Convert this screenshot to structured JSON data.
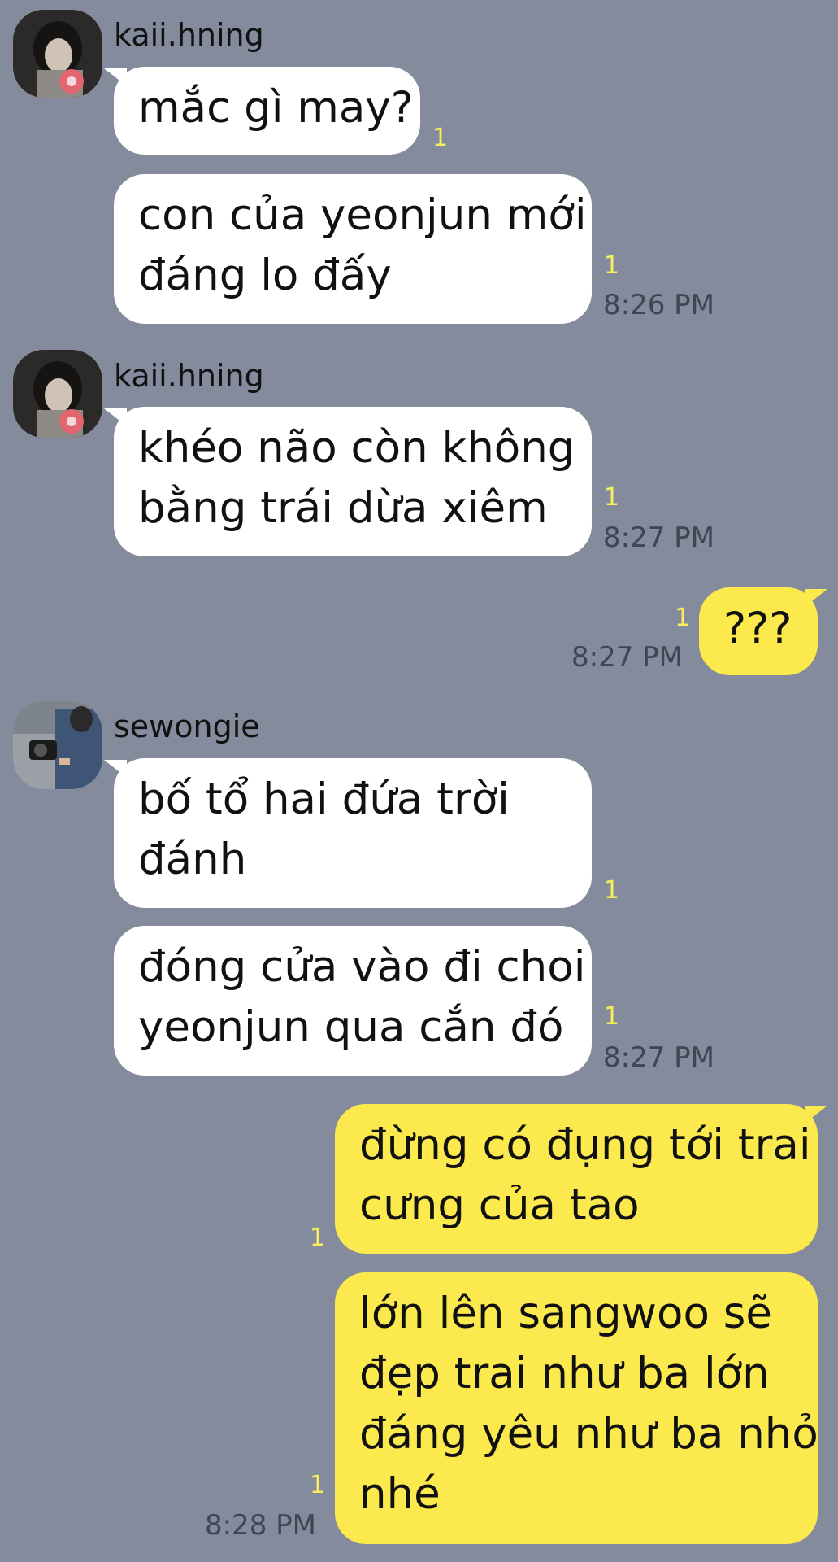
{
  "chat": {
    "messages": [
      {
        "sender": "kaii.hning",
        "direction": "incoming",
        "bubbles": [
          {
            "lines": [
              "mắc gì may?"
            ],
            "read_count": "1"
          },
          {
            "lines": [
              "con của yeonjun mới",
              "đáng lo đấy"
            ],
            "read_count": "1",
            "time": "8:26 PM"
          }
        ]
      },
      {
        "sender": "kaii.hning",
        "direction": "incoming",
        "bubbles": [
          {
            "lines": [
              "khéo não còn không",
              "bằng trái dừa xiêm"
            ],
            "read_count": "1",
            "time": "8:27 PM"
          }
        ]
      },
      {
        "sender": "",
        "direction": "outgoing",
        "bubbles": [
          {
            "lines": [
              "???"
            ],
            "read_count": "1",
            "time": "8:27 PM"
          }
        ]
      },
      {
        "sender": "sewongie",
        "direction": "incoming",
        "bubbles": [
          {
            "lines": [
              "bố tổ hai đứa trời",
              "đánh"
            ],
            "read_count": "1"
          },
          {
            "lines": [
              "đóng cửa vào đi choi",
              "yeonjun qua cắn đó"
            ],
            "read_count": "1",
            "time": "8:27 PM"
          }
        ]
      },
      {
        "sender": "",
        "direction": "outgoing",
        "bubbles": [
          {
            "lines": [
              "đừng có đụng tới trai",
              "cưng của tao"
            ],
            "read_count": "1"
          },
          {
            "lines": [
              "lớn lên sangwoo sẽ",
              "đẹp trai như ba lớn",
              "đáng yêu như ba nhỏ",
              "nhé"
            ],
            "read_count": "1",
            "time": "8:28 PM"
          }
        ]
      }
    ]
  },
  "avatars": {
    "kaii_hning": "profile-photo-dark-hoodie",
    "sewongie": "profile-photo-camera-denim"
  },
  "colors": {
    "background": "#838b9c",
    "incoming_bubble": "#ffffff",
    "outgoing_bubble": "#fce94e",
    "read_count": "#f6ef5a",
    "timestamp": "#3f4552"
  }
}
